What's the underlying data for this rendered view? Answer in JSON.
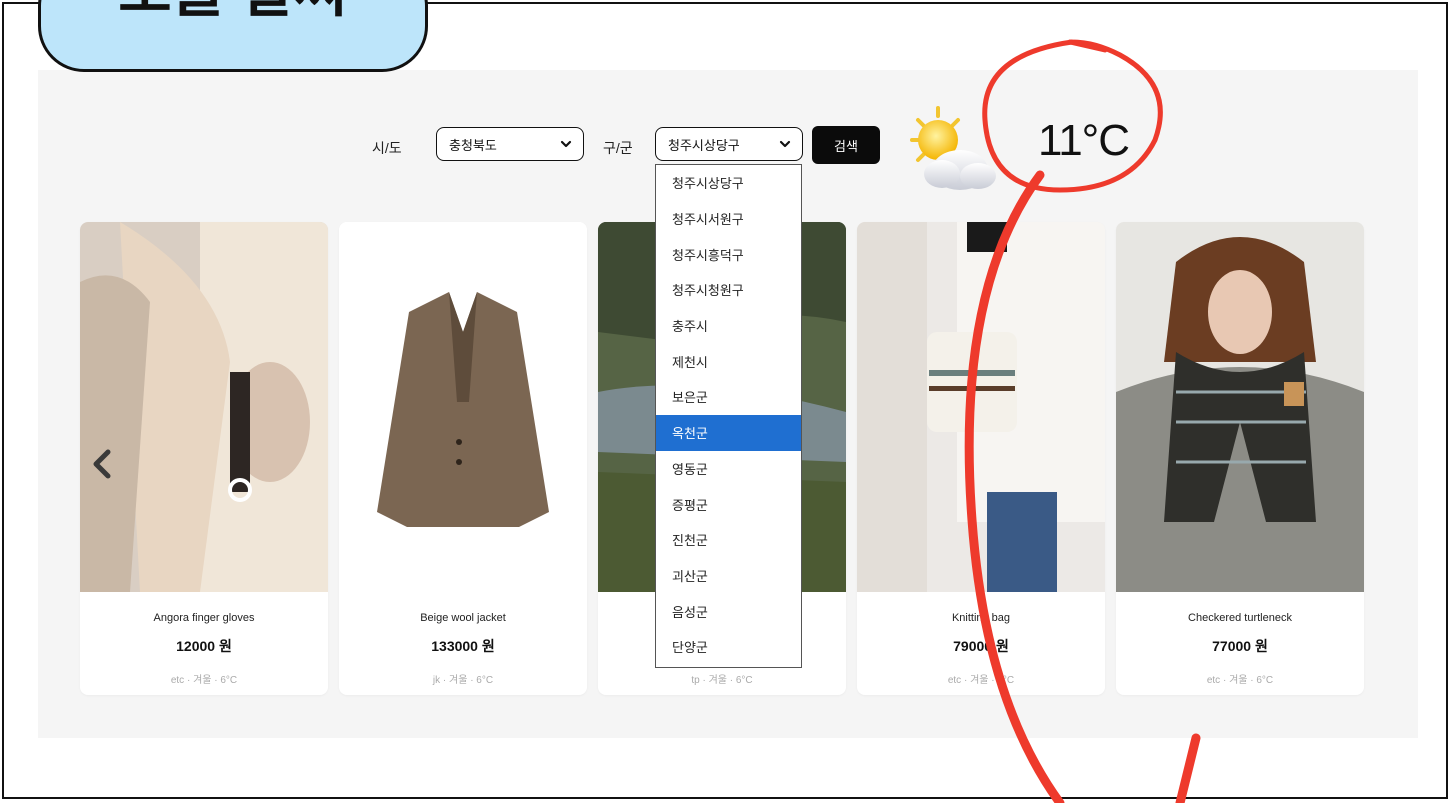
{
  "header": {
    "title": "오늘 날씨"
  },
  "filters": {
    "sido_label": "시/도",
    "sido_value": "충청북도",
    "gugun_label": "구/군",
    "gugun_value": "청주시상당구",
    "search_button": "검색"
  },
  "weather": {
    "temperature": "11°C",
    "icon": "partly-cloudy-icon"
  },
  "dropdown_options": [
    "청주시상당구",
    "청주시서원구",
    "청주시흥덕구",
    "청주시청원구",
    "충주시",
    "제천시",
    "보은군",
    "옥천군",
    "영동군",
    "증평군",
    "진천군",
    "괴산군",
    "음성군",
    "단양군"
  ],
  "dropdown_selected": "옥천군",
  "products": [
    {
      "name": "Angora finger gloves",
      "price": "12000 원",
      "meta": "etc · 겨울 · 6°C"
    },
    {
      "name": "Beige wool jacket",
      "price": "133000 원",
      "meta": "jk · 겨울 · 6°C"
    },
    {
      "name": "",
      "price": "",
      "meta": "tp · 겨울 · 6°C"
    },
    {
      "name": "Knitting bag",
      "price": "79000 원",
      "meta": "etc · 겨울 · 6°C"
    },
    {
      "name": "Checkered turtleneck",
      "price": "77000 원",
      "meta": "etc · 겨울 · 6°C"
    }
  ],
  "colors": {
    "accent": "#1f6fd1",
    "title_tab": "#bde5fa",
    "annotation": "#ee3a2c",
    "panel": "#f5f5f5"
  }
}
